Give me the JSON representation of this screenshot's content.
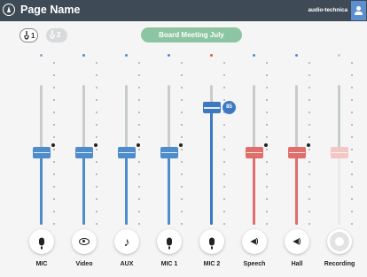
{
  "header": {
    "title": "Page Name",
    "brand": "audio-technica",
    "icons": [
      "app-logo-icon",
      "user-icon"
    ]
  },
  "toolbar": {
    "presets": [
      {
        "number": "1",
        "active": true
      },
      {
        "number": "2",
        "active": false
      }
    ],
    "meeting_name": "Board Meeting July",
    "meeting_color": "#8cc5a1"
  },
  "channels": [
    {
      "label": "MIC",
      "icon": "microphone-icon",
      "color": "#4e8ccc",
      "level": 0.52,
      "led_color": "#8aa8c9",
      "nominal": true
    },
    {
      "label": "Video",
      "icon": "video-icon",
      "color": "#4e8ccc",
      "level": 0.52,
      "led_color": "#4e8ccc",
      "nominal": true
    },
    {
      "label": "AUX",
      "icon": "music-note-icon",
      "color": "#4e8ccc",
      "level": 0.52,
      "led_color": "#4e8ccc",
      "nominal": true
    },
    {
      "label": "MIC 1",
      "icon": "microphone-icon",
      "color": "#4e8ccc",
      "level": 0.52,
      "led_color": "#4e8ccc",
      "nominal": true
    },
    {
      "label": "MIC 2",
      "icon": "microphone-icon",
      "color": "#3d79c2",
      "level": 0.84,
      "led_color": "#e05a4e",
      "nominal": false,
      "badge": "85"
    },
    {
      "label": "Speech",
      "icon": "speaker-icon",
      "color": "#e06e6a",
      "level": 0.52,
      "led_color": "#4e8ccc",
      "nominal": true
    },
    {
      "label": "Hall",
      "icon": "speaker-icon",
      "color": "#e06e6a",
      "level": 0.52,
      "led_color": "#4e8ccc",
      "nominal": true
    },
    {
      "label": "Recording",
      "icon": "record-icon",
      "color": "#f3c7c4",
      "level": 0.52,
      "led_color": "#c8cccd",
      "nominal": false,
      "disabled": true
    }
  ]
}
